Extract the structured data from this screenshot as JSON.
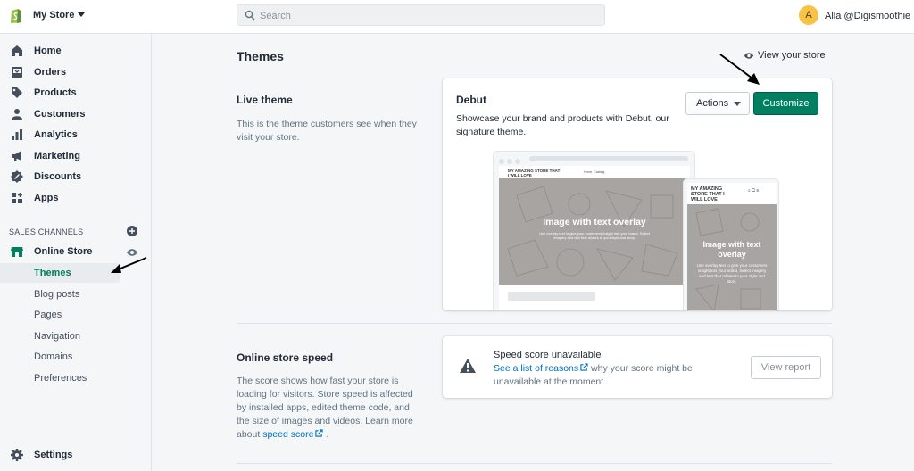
{
  "topbar": {
    "store_name": "My Store",
    "search_placeholder": "Search",
    "avatar_initial": "A",
    "user_name": "Alla @Digismoothie"
  },
  "sidebar": {
    "items": [
      {
        "label": "Home",
        "icon": "home-icon"
      },
      {
        "label": "Orders",
        "icon": "orders-icon"
      },
      {
        "label": "Products",
        "icon": "tag-icon"
      },
      {
        "label": "Customers",
        "icon": "person-icon"
      },
      {
        "label": "Analytics",
        "icon": "bar-chart-icon"
      },
      {
        "label": "Marketing",
        "icon": "megaphone-icon"
      },
      {
        "label": "Discounts",
        "icon": "discount-icon"
      },
      {
        "label": "Apps",
        "icon": "apps-icon"
      }
    ],
    "sales_channels_heading": "SALES CHANNELS",
    "online_store_label": "Online Store",
    "sub_items": [
      "Themes",
      "Blog posts",
      "Pages",
      "Navigation",
      "Domains",
      "Preferences"
    ],
    "settings_label": "Settings"
  },
  "main": {
    "title": "Themes",
    "view_store": "View your store",
    "live_theme": {
      "title": "Live theme",
      "description": "This is the theme customers see when they visit your store."
    },
    "theme_card": {
      "name": "Debut",
      "description": "Showcase your brand and products with Debut, our signature theme.",
      "actions_label": "Actions",
      "customize_label": "Customize",
      "preview": {
        "store_logo": "MY AMAZING STORE THAT I WILL LOVE",
        "nav_home": "Home",
        "nav_catalog": "Catalog",
        "hero_title": "Image with text overlay",
        "hero_text": "Use overlay text to give your customers insight into your brand. Select imagery and text that relates to your style and story."
      }
    },
    "speed": {
      "title": "Online store speed",
      "description_pre": "The score shows how fast your store is loading for visitors. Store speed is affected by installed apps, edited theme code, and the size of images and videos. Learn more about ",
      "description_link": "speed score",
      "description_post": " .",
      "card_title": "Speed score unavailable",
      "card_link": "See a list of reasons",
      "card_text": " why your score might be unavailable at the moment.",
      "view_report_label": "View report"
    }
  },
  "colors": {
    "brand_green": "#008060",
    "link_blue": "#006fbb",
    "avatar_yellow": "#f7c245"
  }
}
